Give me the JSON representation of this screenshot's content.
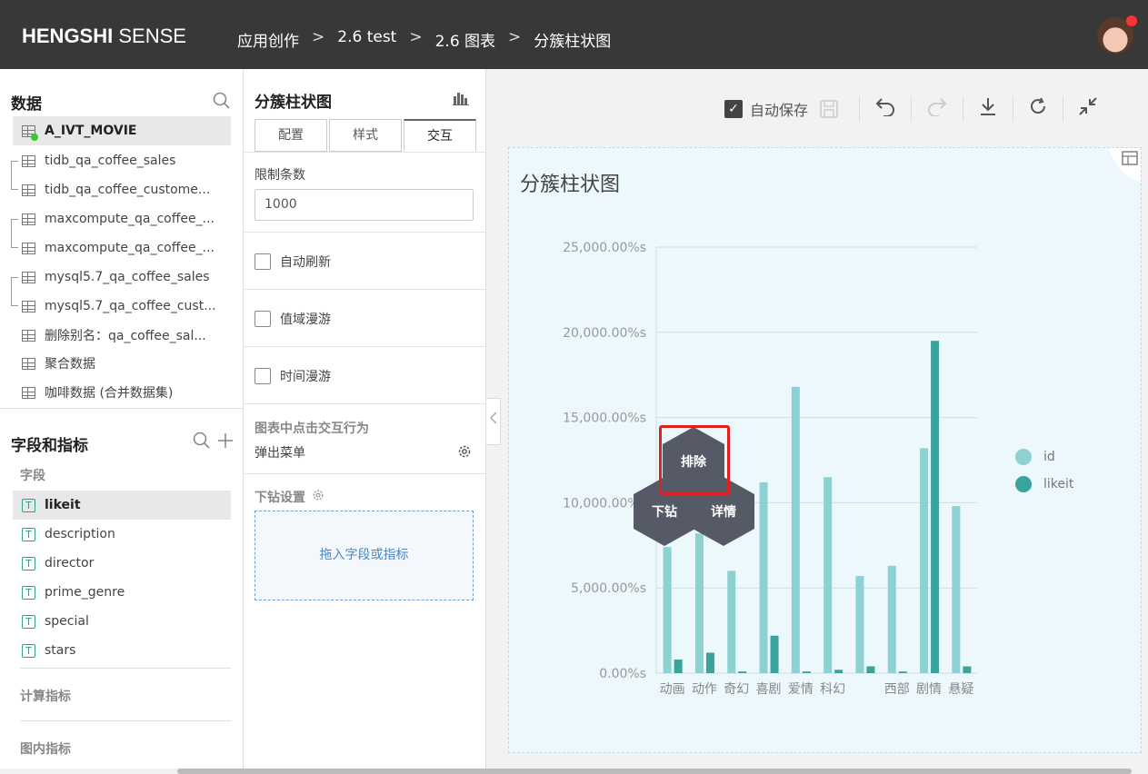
{
  "app": {
    "brand_bold": "HENGSHI",
    "brand_light": " SENSE"
  },
  "breadcrumb": [
    "应用创作",
    "2.6 test",
    "2.6 图表",
    "分簇柱状图"
  ],
  "breadcrumb_sep": ">",
  "left": {
    "data_title": "数据",
    "datasets": [
      "A_IVT_MOVIE",
      "tidb_qa_coffee_sales",
      "tidb_qa_coffee_custome...",
      "maxcompute_qa_coffee_...",
      "maxcompute_qa_coffee_...",
      "mysql5.7_qa_coffee_sales",
      "mysql5.7_qa_coffee_cust...",
      "删除别名：qa_coffee_sal...",
      "聚合数据",
      "咖啡数据 (合并数据集)"
    ],
    "fields_title": "字段和指标",
    "fields_sub": "字段",
    "fields": [
      "likeit",
      "description",
      "director",
      "prime_genre",
      "special",
      "stars"
    ],
    "field_icon": "T",
    "calc_title": "计算指标",
    "inchart_title": "图内指标"
  },
  "mid": {
    "title": "分簇柱状图",
    "tabs": [
      "配置",
      "样式",
      "交互"
    ],
    "limit_label": "限制条数",
    "limit_value": "1000",
    "checks": [
      "自动刷新",
      "值域漫游",
      "时间漫游"
    ],
    "click_title": "图表中点击交互行为",
    "click_value": "弹出菜单",
    "drill_title": "下钻设置",
    "drop_text": "拖入字段或指标"
  },
  "toolbar": {
    "autosave": "自动保存",
    "check": "✓"
  },
  "chart_data": {
    "type": "bar",
    "title": "分簇柱状图",
    "categories": [
      "动画",
      "动作",
      "奇幻",
      "喜剧",
      "爱情",
      "科幻",
      "",
      "西部",
      "剧情",
      "悬疑"
    ],
    "series": [
      {
        "name": "id",
        "color": "#8dd1d3",
        "values": [
          7400,
          8200,
          6000,
          11200,
          16800,
          11500,
          5700,
          6300,
          13200,
          9800
        ]
      },
      {
        "name": "likeit",
        "color": "#3aa39b",
        "values": [
          800,
          1200,
          100,
          2200,
          100,
          200,
          400,
          100,
          19500,
          400
        ]
      }
    ],
    "yticks": [
      "0.00%s",
      "5,000.00%s",
      "10,000.00%s",
      "15,000.00%s",
      "20,000.00%s",
      "25,000.00%s"
    ],
    "ylim": [
      0,
      25000
    ]
  },
  "popup": {
    "exclude": "排除",
    "drill": "下钻",
    "detail": "详情"
  }
}
